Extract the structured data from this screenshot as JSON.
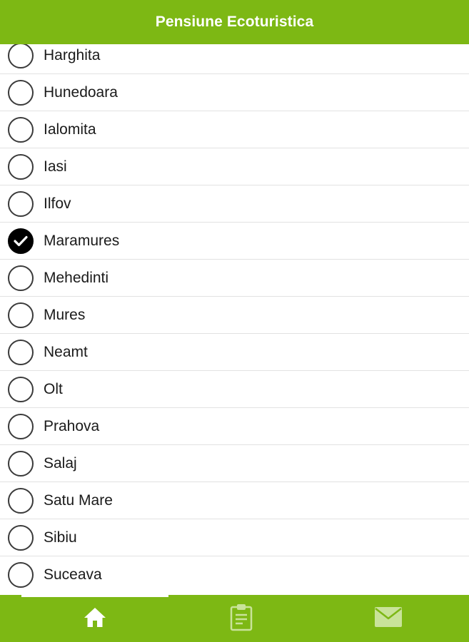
{
  "header": {
    "title": "Pensiune Ecoturistica"
  },
  "counties": [
    {
      "label": "Harghita",
      "checked": false
    },
    {
      "label": "Hunedoara",
      "checked": false
    },
    {
      "label": "Ialomita",
      "checked": false
    },
    {
      "label": "Iasi",
      "checked": false
    },
    {
      "label": "Ilfov",
      "checked": false
    },
    {
      "label": "Maramures",
      "checked": true
    },
    {
      "label": "Mehedinti",
      "checked": false
    },
    {
      "label": "Mures",
      "checked": false
    },
    {
      "label": "Neamt",
      "checked": false
    },
    {
      "label": "Olt",
      "checked": false
    },
    {
      "label": "Prahova",
      "checked": false
    },
    {
      "label": "Salaj",
      "checked": false
    },
    {
      "label": "Satu Mare",
      "checked": false
    },
    {
      "label": "Sibiu",
      "checked": false
    },
    {
      "label": "Suceava",
      "checked": false
    }
  ],
  "tabbar": {
    "tabs": [
      {
        "icon": "home-icon",
        "active": true
      },
      {
        "icon": "clipboard-icon",
        "active": false
      },
      {
        "icon": "mail-icon",
        "active": false
      }
    ]
  },
  "colors": {
    "accent": "#7db814",
    "active_icon": "#ffffff",
    "inactive_icon": "#c9e39a"
  }
}
